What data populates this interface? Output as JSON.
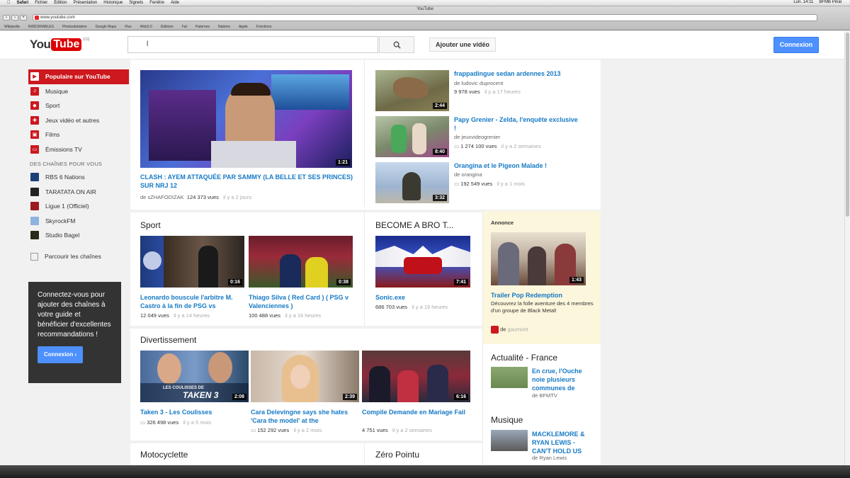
{
  "menubar": {
    "items": [
      "Safari",
      "Fichier",
      "Édition",
      "Présentation",
      "Historique",
      "Signets",
      "Fenêtre",
      "Aide"
    ],
    "right": [
      "Lun. 14:11",
      "BFMB Pinal"
    ]
  },
  "browser": {
    "title": "YouTube",
    "url": "www.youtube.com",
    "bookmarks": [
      "Wikipedia",
      "INDÉSIRABLES",
      "Photosdeitation",
      "Google Maps",
      "Flux",
      "Web2.0",
      "Éditions",
      "Fat",
      "Paternes",
      "Nations",
      "Apple",
      "Fonctions"
    ]
  },
  "header": {
    "logo_you": "You",
    "logo_tube": "Tube",
    "logo_region": "FR",
    "search_value": "l",
    "upload_label": "Ajouter une vidéo",
    "signin_label": "Connexion"
  },
  "guide": {
    "items": [
      {
        "label": "Populaire sur YouTube"
      },
      {
        "label": "Musique"
      },
      {
        "label": "Sport"
      },
      {
        "label": "Jeux vidéo et autres"
      },
      {
        "label": "Films"
      },
      {
        "label": "Émissions TV"
      }
    ],
    "heading": "DES CHAÎNES POUR VOUS",
    "channels": [
      {
        "label": "RBS 6 Nations"
      },
      {
        "label": "TARATATA ON AIR"
      },
      {
        "label": "Ligue 1 (Officiel)"
      },
      {
        "label": "SkyrockFM"
      },
      {
        "label": "Studio Bagel"
      }
    ],
    "browse_label": "Parcourir les chaînes",
    "promo_text": "Connectez-vous pour ajouter des chaînes à votre guide et bénéficier d'excellentes recommandations !",
    "promo_button": "Connexion ›"
  },
  "featured": {
    "title": "CLASH : AYEM ATTAQUÉE PAR SAMMY (LA BELLE ET SES PRINCES) SUR NRJ 12",
    "channel": "de sZHAFODIZAK",
    "views": "124 373 vues",
    "age": "il y a 2 jours",
    "duration": "1:21"
  },
  "side_videos": [
    {
      "title": "frappadingue sedan ardennes 2013",
      "channel": "de ludovic duprocent",
      "views": "9 978 vues",
      "age": "il y a 17 heures",
      "duration": "2:44"
    },
    {
      "title": "Papy Grenier - Zelda, l'enquête exclusive !",
      "channel": "de jeuxvideogrenier",
      "views": "1 274 100 vues",
      "age": "il y a 2 semaines",
      "duration": "8:40"
    },
    {
      "title": "Orangina et le Pigeon Malade !",
      "channel": "de orangina",
      "views": "192 549 vues",
      "age": "il y a 1 mois",
      "duration": "3:32"
    }
  ],
  "sport": {
    "title": "Sport",
    "videos": [
      {
        "title": "Leonardo bouscule l'arbitre M. Castro à la fin de PSG vs",
        "views": "12 049 vues",
        "age": "il y a 14 heures",
        "duration": "0:16"
      },
      {
        "title": "Thiago Silva ( Red Card ) ( PSG v Valenciennes )",
        "views": "100 488 vues",
        "age": "il y a 16 heures",
        "duration": "0:38"
      }
    ]
  },
  "become": {
    "title": "BECOME A BRO T...",
    "video": {
      "title": "Sonic.exe",
      "views": "686 703 vues",
      "age": "il y a 19 heures",
      "duration": "7:41"
    }
  },
  "ad": {
    "label": "Annonce",
    "title": "Trailer Pop Redemption",
    "desc": "Découvrez la folle aventure des 4 membres d'un groupe de Black Metal!",
    "by": "de",
    "advertiser": "gaumont",
    "duration": "1:43"
  },
  "divertissement": {
    "title": "Divertissement",
    "videos": [
      {
        "title": "Taken 3 - Les Coulisses",
        "views": "326 498 vues",
        "age": "il y a 5 mois",
        "duration": "2:08",
        "overlay1": "LES COULISSES DE",
        "overlay2": "TAKEN 3"
      },
      {
        "title": "Cara Delevingne says she hates 'Cara the model' at the",
        "views": "152 292 vues",
        "age": "il y a 2 mois",
        "duration": "2:39"
      },
      {
        "title": "Compile Demande en Mariage Fail",
        "views": "4 751 vues",
        "age": "il y a 2 semaines",
        "duration": "6:16"
      }
    ]
  },
  "actualite": {
    "title": "Actualité - France",
    "video": {
      "title": "En crue, l'Ouche noie plusieurs communes de",
      "channel": "de BFMTV"
    }
  },
  "musique": {
    "title": "Musique",
    "video": {
      "title": "MACKLEMORE & RYAN LEWIS - CAN'T HOLD US",
      "channel": "de Ryan Lewis"
    }
  },
  "bottom_sections": {
    "left": "Motocyclette",
    "right": "Zéro Pointu"
  }
}
